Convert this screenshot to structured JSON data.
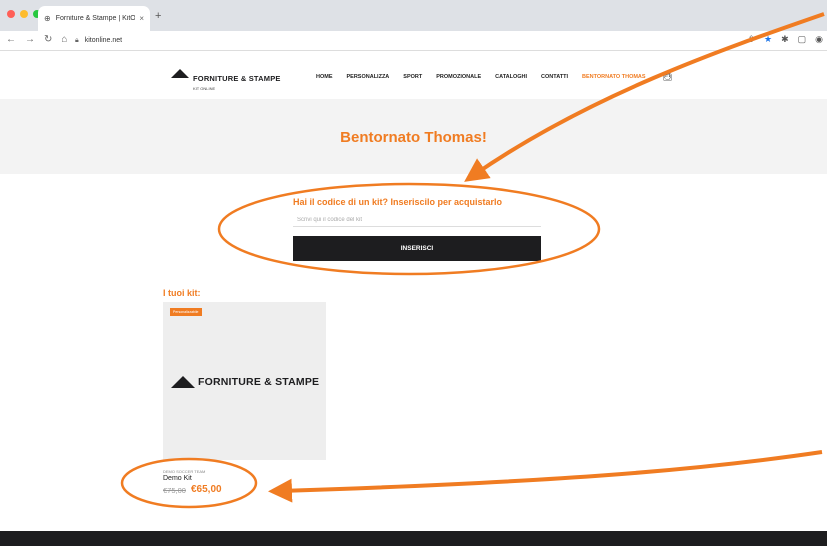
{
  "browser": {
    "tab_title": "Forniture & Stampe | KitOnLine",
    "tab_close": "×",
    "new_tab": "+",
    "url": "kitonline.net",
    "dot_colors": [
      "#ff5f57",
      "#febc2e",
      "#28c840"
    ]
  },
  "header": {
    "logo_brand": "FORNITURE & STAMPE",
    "logo_sub": "KIT ONLINE",
    "menu": [
      {
        "label": "HOME"
      },
      {
        "label": "PERSONALIZZA"
      },
      {
        "label": "SPORT"
      },
      {
        "label": "PROMOZIONALE"
      },
      {
        "label": "CATALOGHI"
      },
      {
        "label": "CONTATTI"
      },
      {
        "label": "BENTORNATO THOMAS"
      }
    ],
    "cart_icon": "bag-icon"
  },
  "hero": {
    "title": "Bentornato Thomas!"
  },
  "code_form": {
    "title": "Hai il codice di un kit? Inseriscilo per acquistarlo",
    "placeholder": "Scrivi qui il codice del kit",
    "button": "INSERISCI"
  },
  "kits": {
    "section_title": "I tuoi kit:",
    "items": [
      {
        "badge": "Personalizzabile",
        "logo_text": "FORNITURE & STAMPE",
        "category": "DEMO SOCCER TEAM",
        "name": "Demo Kit",
        "old_price": "€75,00",
        "price": "€65,00"
      }
    ]
  },
  "colors": {
    "accent": "#f07c22",
    "dark": "#1d1d1f",
    "annotation": "#f07c22"
  }
}
